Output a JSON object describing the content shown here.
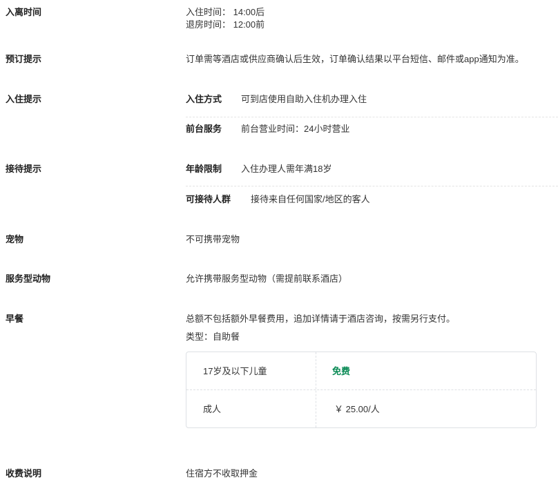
{
  "sections": {
    "checkin_out": {
      "label": "入离时间",
      "checkin": "入住时间： 14:00后",
      "checkout": "退房时间： 12:00前"
    },
    "booking": {
      "label": "预订提示",
      "text": "订单需等酒店或供应商确认后生效，订单确认结果以平台短信、邮件或app通知为准。"
    },
    "checkin_tips": {
      "label": "入住提示",
      "items": [
        {
          "key": "入住方式",
          "value": "可到店使用自助入住机办理入住"
        },
        {
          "key": "前台服务",
          "value": "前台营业时间：24小时营业"
        }
      ]
    },
    "reception": {
      "label": "接待提示",
      "items": [
        {
          "key": "年龄限制",
          "value": "入住办理人需年满18岁"
        },
        {
          "key": "可接待人群",
          "value": "接待来自任何国家/地区的客人"
        }
      ]
    },
    "pets": {
      "label": "宠物",
      "text": "不可携带宠物"
    },
    "service_animals": {
      "label": "服务型动物",
      "text": "允许携带服务型动物（需提前联系酒店）"
    },
    "breakfast": {
      "label": "早餐",
      "text": "总额不包括额外早餐费用，追加详情请于酒店咨询，按需另行支付。",
      "type": "类型：自助餐",
      "prices": [
        {
          "who": "17岁及以下儿童",
          "price": "免费"
        },
        {
          "who": "成人",
          "price": "￥ 25.00/人"
        }
      ]
    },
    "fees": {
      "label": "收费说明",
      "text": "住宿方不收取押金"
    }
  },
  "colors": {
    "free": "#0a8a55"
  }
}
